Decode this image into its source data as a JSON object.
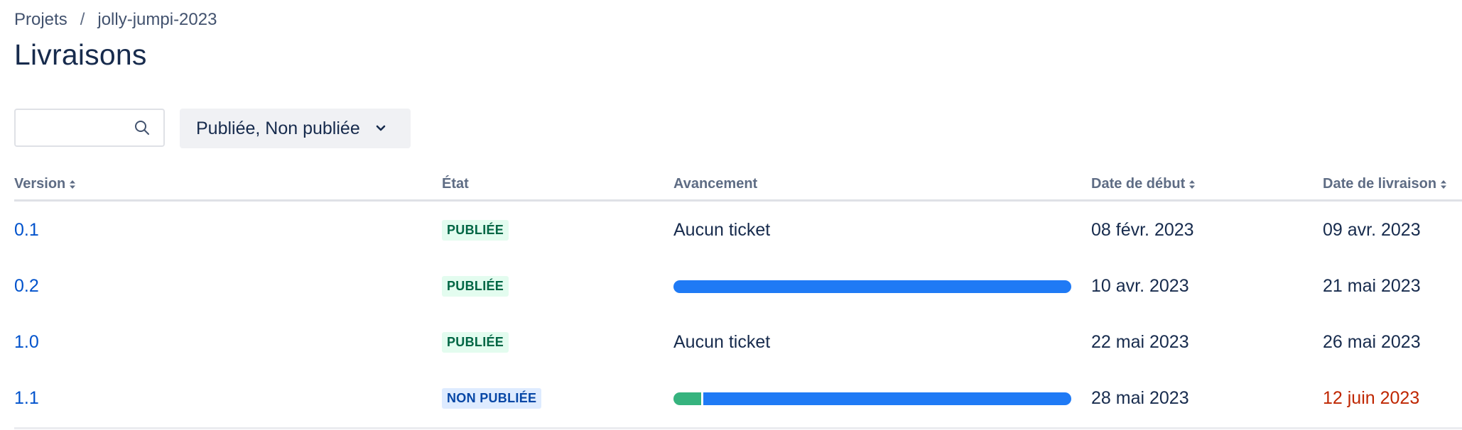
{
  "breadcrumb": {
    "projects": "Projets",
    "separator": "/",
    "project": "jolly-jumpi-2023"
  },
  "page": {
    "title": "Livraisons"
  },
  "search": {
    "value": "",
    "placeholder": ""
  },
  "filter": {
    "label": "Publiée, Non publiée"
  },
  "table": {
    "headers": {
      "version": "Version",
      "state": "État",
      "progress": "Avancement",
      "start": "Date de début",
      "release": "Date de livraison"
    },
    "rows": [
      {
        "version": "0.1",
        "state": "PUBLIÉE",
        "state_kind": "released",
        "progress_text": "Aucun ticket",
        "progress": null,
        "start": "08 févr. 2023",
        "release": "09 avr. 2023",
        "release_overdue": false
      },
      {
        "version": "0.2",
        "state": "PUBLIÉE",
        "state_kind": "released",
        "progress_text": "",
        "progress": {
          "done_fraction": 0.0,
          "todo_fraction": 1.0
        },
        "start": "10 avr. 2023",
        "release": "21 mai 2023",
        "release_overdue": false
      },
      {
        "version": "1.0",
        "state": "PUBLIÉE",
        "state_kind": "released",
        "progress_text": "Aucun ticket",
        "progress": null,
        "start": "22 mai 2023",
        "release": "26 mai 2023",
        "release_overdue": false
      },
      {
        "version": "1.1",
        "state": "NON PUBLIÉE",
        "state_kind": "unreleased",
        "progress_text": "",
        "progress": {
          "done_fraction": 0.07,
          "todo_fraction": 0.93
        },
        "start": "28 mai 2023",
        "release": "12 juin 2023",
        "release_overdue": true
      }
    ]
  },
  "colors": {
    "link": "#0052cc",
    "released_bg": "#e3fcef",
    "released_fg": "#006644",
    "unreleased_bg": "#deebff",
    "unreleased_fg": "#0747a6",
    "progress_done": "#36b37e",
    "progress_todo": "#1f7af5",
    "overdue": "#bf2600"
  }
}
